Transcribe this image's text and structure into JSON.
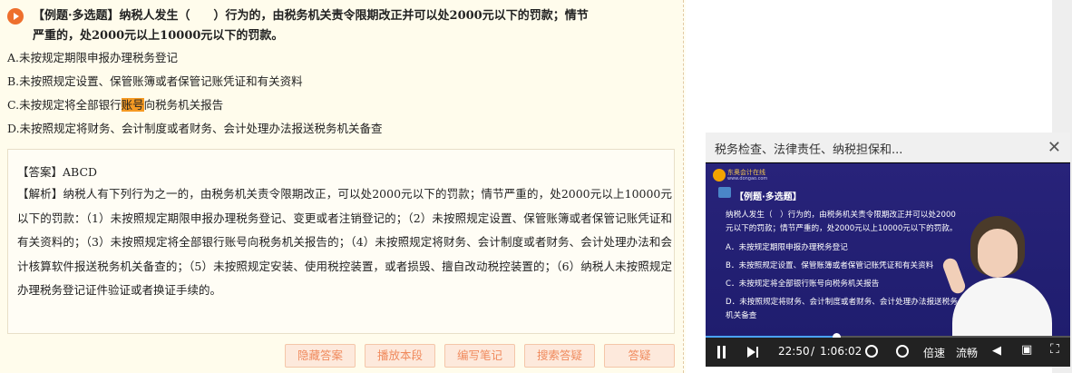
{
  "question": {
    "line1": "【例题·多选题】纳税人发生（　　）行为的，由税务机关责令限期改正并可以处2000元以下的罚款；情节",
    "line2": "严重的，处2000元以上10000元以下的罚款。"
  },
  "options": [
    {
      "pre": "A.未按规定期限申报办理税务登记",
      "hl": "",
      "post": ""
    },
    {
      "pre": "B.未按照规定设置、保管账簿或者保管记账凭证和有关资料",
      "hl": "",
      "post": ""
    },
    {
      "pre": "C.未按规定将全部银行",
      "hl": "账号",
      "post": "向税务机关报告"
    },
    {
      "pre": "D.未按照规定将财务、会计制度或者财务、会计处理办法报送税务机关备查",
      "hl": "",
      "post": ""
    }
  ],
  "answer": {
    "label": "【答案】ABCD",
    "analysis": "【解析】纳税人有下列行为之一的，由税务机关责令限期改正，可以处2000元以下的罚款；情节严重的，处2000元以上10000元以下的罚款：（1）未按照规定期限申报办理税务登记、变更或者注销登记的；（2）未按照规定设置、保管账簿或者保管记账凭证和有关资料的；（3）未按照规定将全部银行账号向税务机关报告的；（4）未按照规定将财务、会计制度或者财务、会计处理办法和会计核算软件报送税务机关备查的；（5）未按照规定安装、使用税控装置，或者损毁、擅自改动税控装置的；（6）纳税人未按照规定办理税务登记证件验证或者换证手续的。"
  },
  "buttons": {
    "hide_answer": "隐藏答案",
    "play_section": "播放本段",
    "write_note": "编写笔记",
    "search_qa": "搜索答疑",
    "ask": "答疑"
  },
  "video": {
    "title": "税务检查、法律责任、纳税担保和...",
    "close": "✕",
    "slide": {
      "logo": "东奥会计在线",
      "logo_sub": "www.dongao.com",
      "heading": "【例题·多选题】",
      "lines": [
        "纳税人发生（　）行为的，由税务机关责令限期改正并可以处2000",
        "元以下的罚款；情节严重的，处2000元以上10000元以下的罚款。",
        "A．未按规定期限申报办理税务登记",
        "B．未按照规定设置、保管账簿或者保管记账凭证和有关资料",
        "C．未按规定将全部银行账号向税务机关报告",
        "D．未按照规定将财务、会计制度或者财务、会计处理办法报送税务",
        "机关备查"
      ]
    },
    "progress": 0.358,
    "current_time": "22:50",
    "separator": "/",
    "total_time": "1:06:02",
    "speed_label": "倍速",
    "quality_label": "流畅",
    "accent": "#4aa3ff"
  },
  "colors": {
    "highlight": "#f59a23",
    "button_text": "#f08a5d",
    "button_bg": "#fde9dc",
    "play_icon": "#ee6f2d"
  }
}
